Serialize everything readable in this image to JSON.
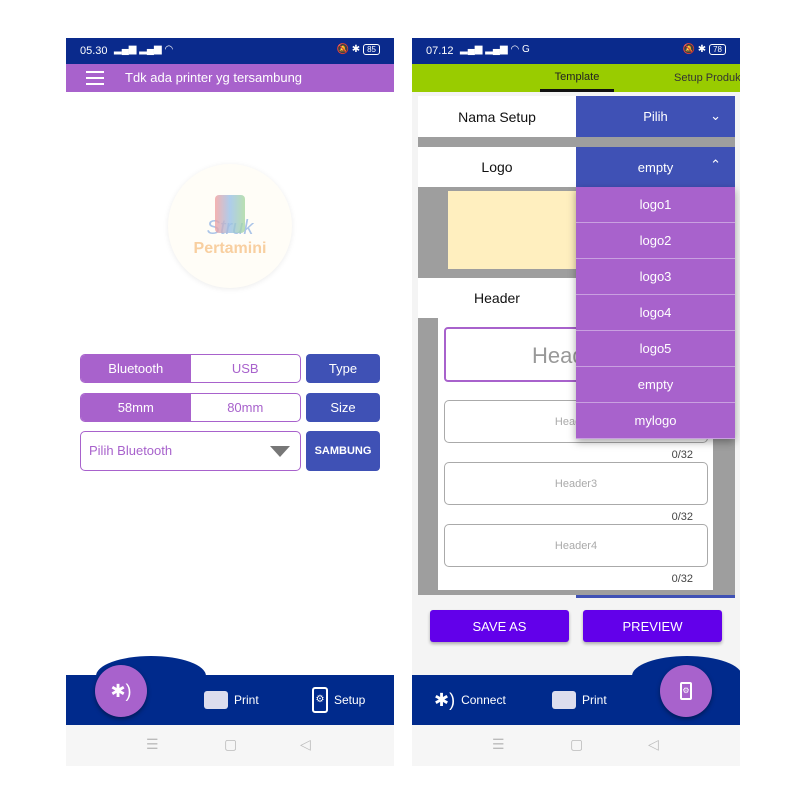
{
  "left": {
    "status": {
      "time": "05.30",
      "signal": "▐▐ ▐▐",
      "battery": "85"
    },
    "appbar": {
      "title": "Tdk ada printer yg tersambung"
    },
    "logo": {
      "line1": "Struk",
      "line2": "Pertamini"
    },
    "type_toggle": {
      "options": [
        "Bluetooth",
        "USB"
      ],
      "selected": "Bluetooth",
      "button": "Type"
    },
    "size_toggle": {
      "options": [
        "58mm",
        "80mm"
      ],
      "selected": "58mm",
      "button": "Size"
    },
    "device_select": {
      "value": "Pilih Bluetooth",
      "button": "SAMBUNG"
    },
    "bottom_nav": {
      "print": "Print",
      "setup": "Setup"
    }
  },
  "right": {
    "status": {
      "time": "07.12",
      "battery": "78"
    },
    "tabs": [
      {
        "label": "Template",
        "active": true
      },
      {
        "label": "Setup Produk",
        "active": false
      }
    ],
    "nama_setup": {
      "label": "Nama Setup",
      "value": "Pilih"
    },
    "logo": {
      "label": "Logo",
      "value": "empty",
      "options": [
        "logo1",
        "logo2",
        "logo3",
        "logo4",
        "logo5",
        "empty",
        "mylogo"
      ]
    },
    "header": {
      "label": "Header",
      "header1_placeholder": "Header1",
      "fields": [
        {
          "placeholder": "Header2",
          "counter": "0/32"
        },
        {
          "placeholder": "Header3",
          "counter": "0/32"
        },
        {
          "placeholder": "Header4",
          "counter": "0/32"
        }
      ]
    },
    "buttons": {
      "save_as": "SAVE AS",
      "preview": "PREVIEW"
    },
    "bottom_nav": {
      "connect": "Connect",
      "print": "Print"
    }
  },
  "colors": {
    "status_bar": "#0a2a8c",
    "appbar_purple": "#a862cc",
    "tab_green": "#99cc00",
    "button_blue": "#3f51b5",
    "button_violet": "#6200ea"
  }
}
